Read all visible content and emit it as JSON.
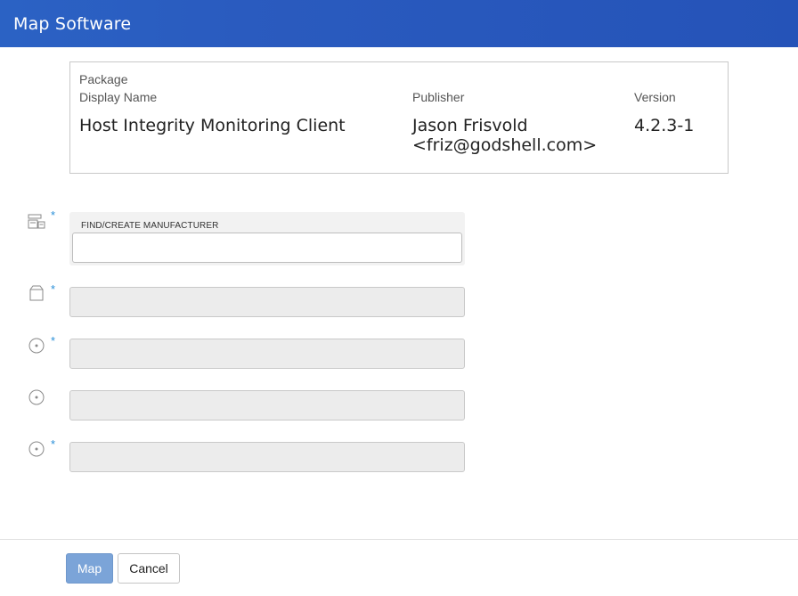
{
  "header": {
    "title": "Map Software"
  },
  "package": {
    "section_label": "Package",
    "display_name_label": "Display Name",
    "display_name": "Host Integrity Monitoring Client",
    "publisher_label": "Publisher",
    "publisher_line1": "Jason Frisvold",
    "publisher_line2": "<friz@godshell.com>",
    "version_label": "Version",
    "version": "4.2.3-1"
  },
  "form": {
    "required_mark": "*",
    "manufacturer": {
      "label": "FIND/CREATE MANUFACTURER",
      "value": "",
      "icon": "manufacturer-icon"
    },
    "product": {
      "value": "",
      "icon": "box-icon"
    },
    "field3": {
      "value": "",
      "icon": "disc-icon"
    },
    "field4": {
      "value": "",
      "icon": "disc-icon"
    },
    "field5": {
      "value": "",
      "icon": "disc-icon"
    }
  },
  "footer": {
    "map_label": "Map",
    "cancel_label": "Cancel"
  },
  "colors": {
    "header": "#2b62c4",
    "required": "#2a8fd8",
    "map_button": "#7ba4d8"
  }
}
